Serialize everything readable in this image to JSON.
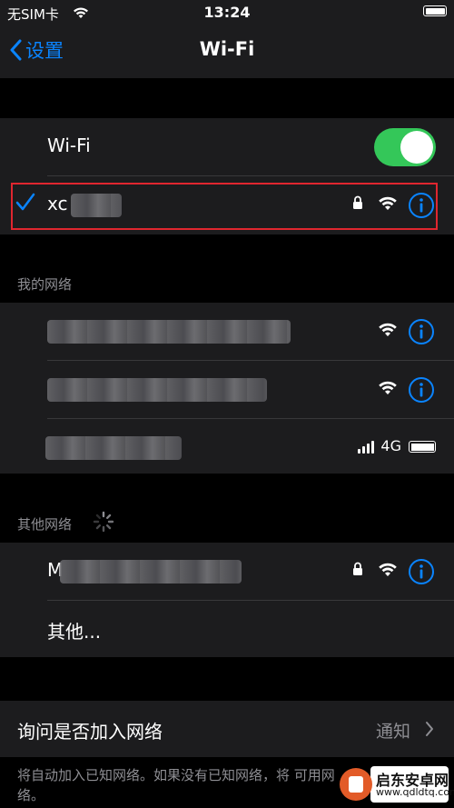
{
  "status_bar": {
    "carrier": "无SIM卡",
    "time": "13:24"
  },
  "nav": {
    "back_label": "设置",
    "title": "Wi-Fi"
  },
  "wifi_toggle": {
    "label": "Wi-Fi",
    "on": true
  },
  "current_network": {
    "name": "xc"
  },
  "my_networks": {
    "header": "我的网络",
    "hotspot_type": "4G"
  },
  "other_networks": {
    "header": "其他网络",
    "first_network_name": "M",
    "other_label": "其他..."
  },
  "ask_to_join": {
    "label": "询问是否加入网络",
    "value": "通知"
  },
  "footnote": "将自动加入已知网络。如果没有已知网络，将 可用网络。",
  "watermark": {
    "name": "启东安卓网",
    "url": "www.qdldtq.com"
  },
  "colors": {
    "accent": "#0a84ff",
    "toggle_on": "#34c759",
    "highlight": "#e0262f",
    "cell_bg": "#1c1c1e",
    "page_bg": "#000000"
  }
}
